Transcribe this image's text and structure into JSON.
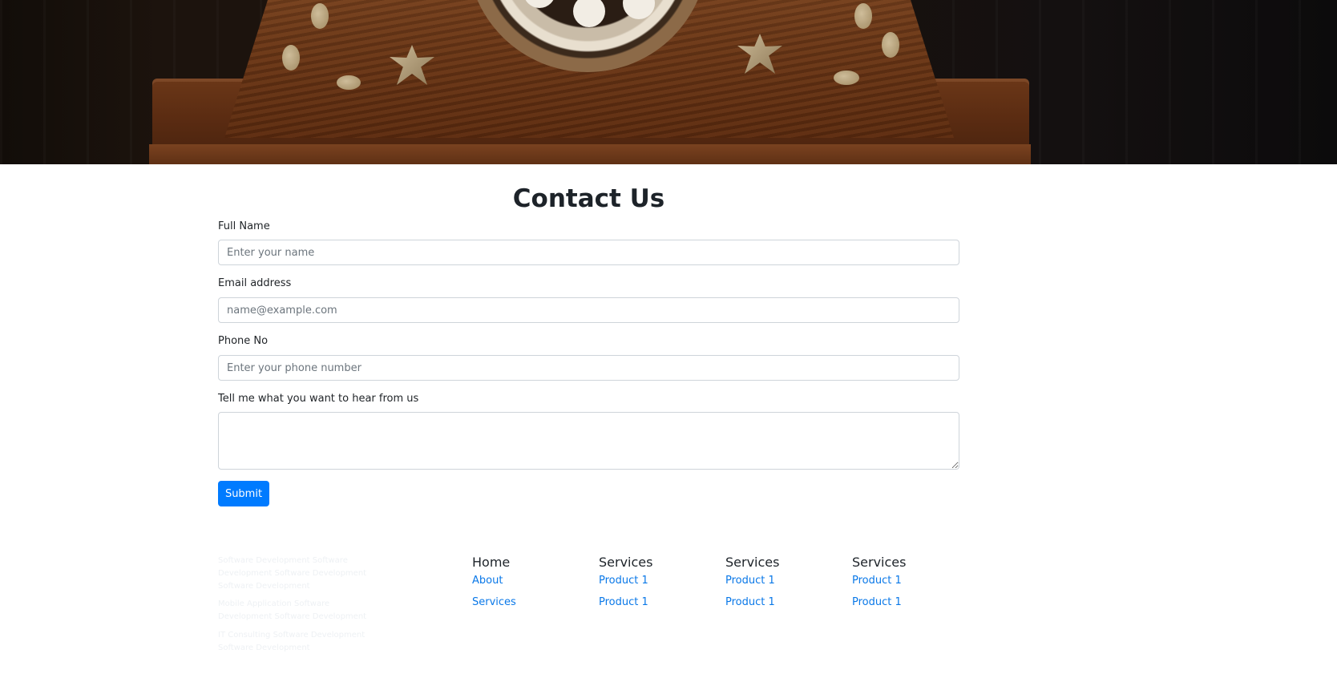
{
  "hero": {
    "image": "antique rotary telephone on dark wooden base"
  },
  "contact": {
    "title": "Contact Us",
    "fields": {
      "name": {
        "label": "Full Name",
        "placeholder": "Enter your name",
        "value": ""
      },
      "email": {
        "label": "Email address",
        "placeholder": "name@example.com",
        "value": ""
      },
      "phone": {
        "label": "Phone No",
        "placeholder": "Enter your phone number",
        "value": ""
      },
      "message": {
        "label": "Tell me what you want to hear from us",
        "placeholder": "",
        "value": ""
      }
    },
    "submit_label": "Submit",
    "accent_color": "#007bff"
  },
  "footer": {
    "faded_text": [
      "Software Development Software Development Software Development Software Development",
      "Mobile Application Software Development Software Development",
      "IT Consulting Software Development Software Development"
    ],
    "columns": [
      {
        "heading": "Home",
        "links": [
          "About",
          "Services"
        ]
      },
      {
        "heading": "Services",
        "links": [
          "Product 1",
          "Product 1"
        ]
      },
      {
        "heading": "Services",
        "links": [
          "Product 1",
          "Product 1"
        ]
      },
      {
        "heading": "Services",
        "links": [
          "Product 1",
          "Product 1"
        ]
      }
    ],
    "link_color": "#0a78e8"
  }
}
